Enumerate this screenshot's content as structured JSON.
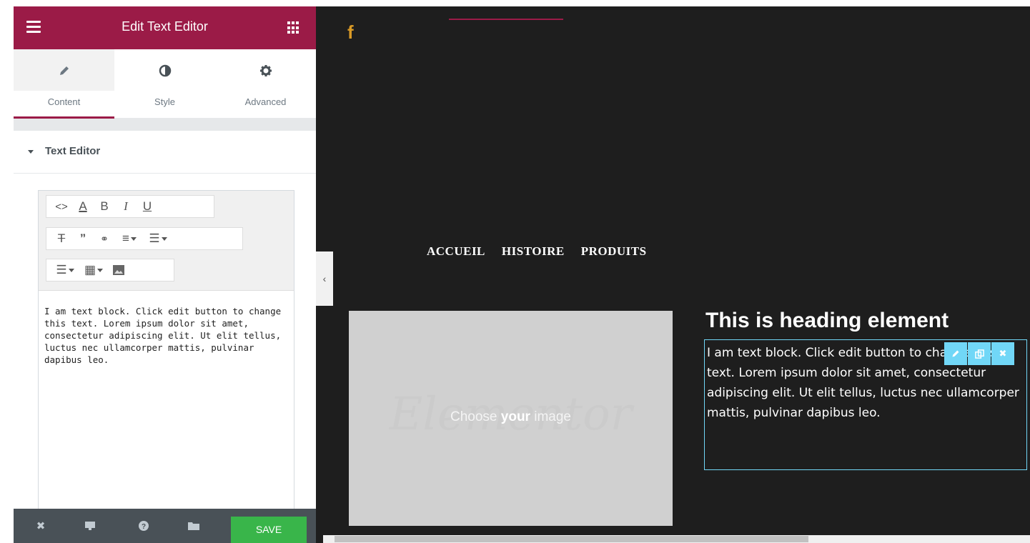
{
  "panel": {
    "title": "Edit Text Editor",
    "tabs": [
      {
        "label": "Content",
        "icon": "pencil-icon",
        "active": true
      },
      {
        "label": "Style",
        "icon": "contrast-icon",
        "active": false
      },
      {
        "label": "Advanced",
        "icon": "gear-icon",
        "active": false
      }
    ],
    "section_title": "Text Editor",
    "editor_text": "I am text block. Click edit button to change this text. Lorem ipsum dolor sit amet, consectetur adipiscing elit. Ut elit tellus, luctus nec ullamcorper mattis, pulvinar dapibus leo.",
    "footer": {
      "save_label": "SAVE"
    }
  },
  "preview": {
    "social_icon": "f",
    "nav": [
      "ACCUEIL",
      "HISTOIRE",
      "PRODUITS"
    ],
    "image_placeholder": {
      "watermark": "Elementor",
      "prefix": "Choose ",
      "bold": "your",
      "suffix": " image"
    },
    "heading": "This is heading element",
    "text_block": "I am text block. Click edit button to change this text. Lorem ipsum dolor sit amet, consectetur adipiscing elit. Ut elit tellus, luctus nec ullamcorper mattis, pulvinar dapibus leo."
  },
  "colors": {
    "brand": "#9b1b47",
    "preview_bg": "#1e1e1e",
    "save_green": "#39b54a",
    "selection_blue": "#71d7f7",
    "footer_bg": "#495157"
  }
}
